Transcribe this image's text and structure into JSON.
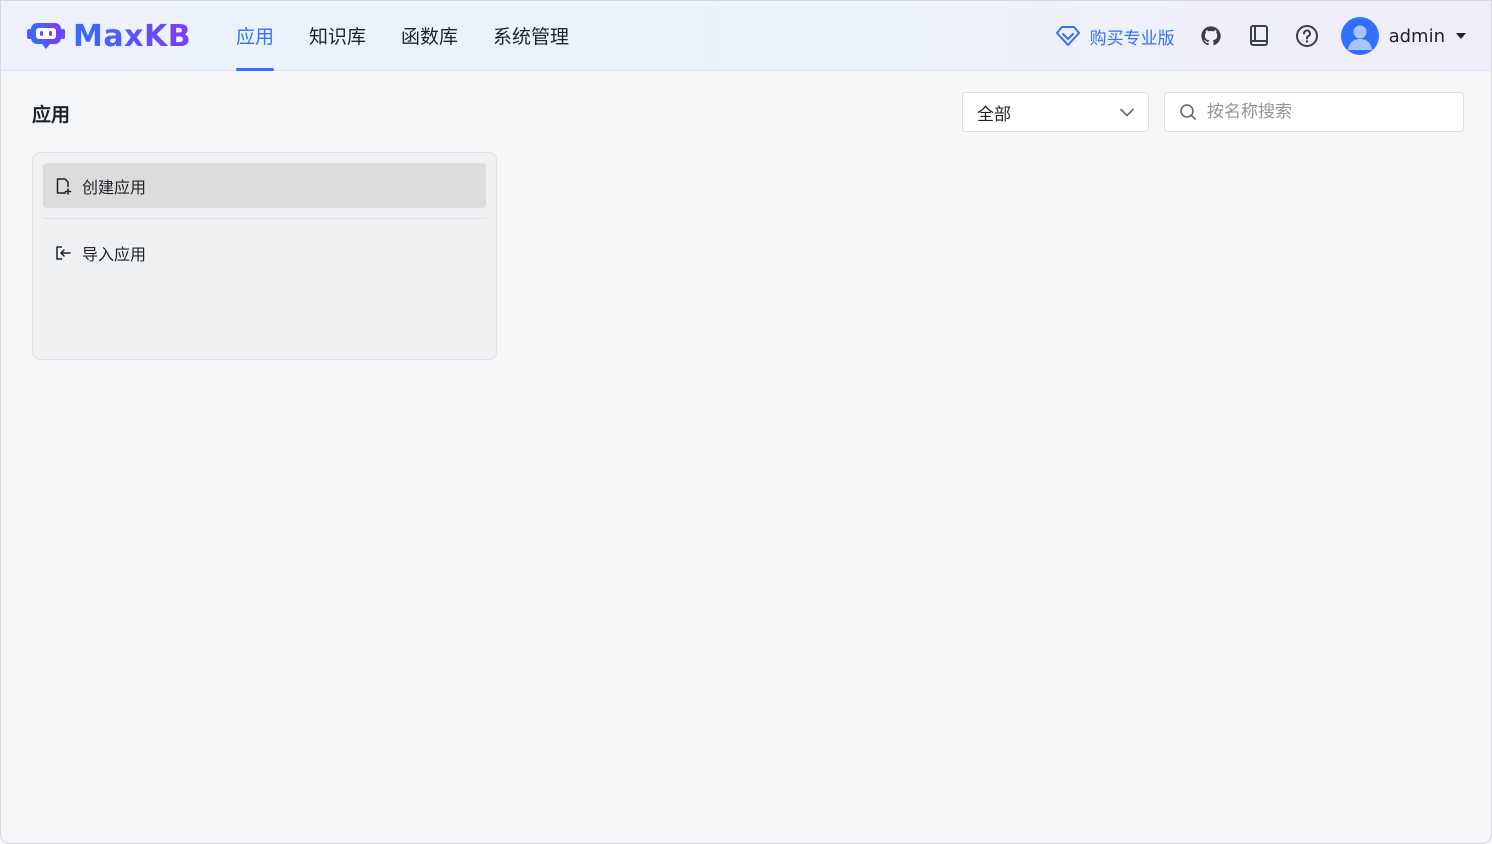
{
  "brand": {
    "name": "MaxKB",
    "accent": "#3370ff",
    "accent2": "#7f3bf5"
  },
  "nav": {
    "items": [
      {
        "label": "应用",
        "active": true
      },
      {
        "label": "知识库",
        "active": false
      },
      {
        "label": "函数库",
        "active": false
      },
      {
        "label": "系统管理",
        "active": false
      }
    ]
  },
  "header": {
    "buy_label": "购买专业版",
    "icons": [
      "github-icon",
      "manual-book-icon",
      "help-icon"
    ],
    "user": {
      "name": "admin"
    }
  },
  "main": {
    "title": "应用",
    "filter": {
      "selected": "全部"
    },
    "search": {
      "placeholder": "按名称搜索",
      "value": ""
    },
    "create_card": {
      "items": [
        {
          "label": "创建应用",
          "icon": "new-file-icon"
        },
        {
          "label": "导入应用",
          "icon": "import-icon"
        }
      ]
    }
  }
}
